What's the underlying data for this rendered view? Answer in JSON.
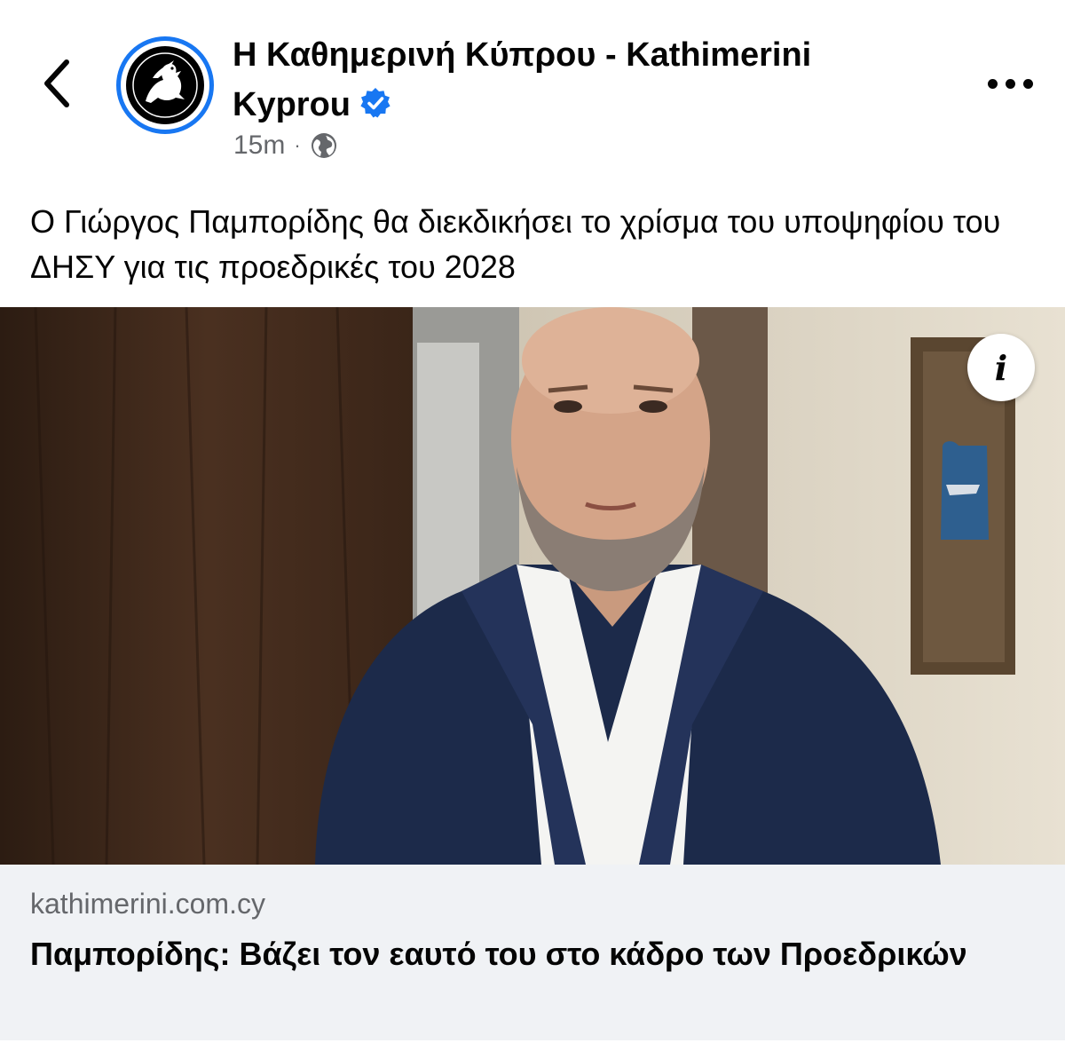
{
  "header": {
    "back_icon": "chevron-left-icon",
    "page_name": "Η Καθημερινή Κύπρου - Kathimerini Kyprou",
    "verified_icon": "verified-badge-icon",
    "time": "15m",
    "separator": "·",
    "audience_icon": "globe-icon",
    "more_icon": "more-horizontal-icon"
  },
  "post": {
    "text": "Ο Γιώργος Παμπορίδης θα διεκδικήσει το χρίσμα του υποψηφίου του ΔΗΣΥ για τις προεδρικές του 2028"
  },
  "link_card": {
    "info_label": "i",
    "domain": "kathimerini.com.cy",
    "headline": "Παμπορίδης: Βάζει τον εαυτό του στο κάδρο των Προεδρικών"
  },
  "colors": {
    "accent": "#1877f2",
    "secondary_text": "#65676b",
    "card_background": "#f0f2f5"
  }
}
